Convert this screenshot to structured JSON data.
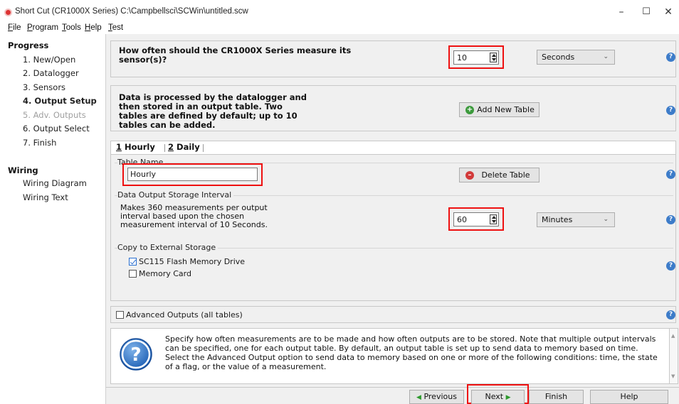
{
  "window": {
    "title": "Short Cut (CR1000X Series) C:\\Campbellsci\\SCWin\\untitled.scw",
    "minimize": "–",
    "maximize": "☐",
    "close": "✕"
  },
  "menu": [
    "File",
    "Program",
    "Tools",
    "Help",
    "Test"
  ],
  "nav": {
    "progress_heading": "Progress",
    "progress_items": [
      "1. New/Open",
      "2. Datalogger",
      "3. Sensors",
      "4. Output Setup",
      "5. Adv. Outputs",
      "6. Output Select",
      "7. Finish"
    ],
    "current_index": 3,
    "disabled_index": 4,
    "wiring_heading": "Wiring",
    "wiring_items": [
      "Wiring Diagram",
      "Wiring Text"
    ]
  },
  "measure": {
    "question": "How often should the CR1000X Series measure its sensor(s)?",
    "interval_value": "10",
    "interval_unit": "Seconds"
  },
  "tables": {
    "description": "Data is processed by the datalogger and then stored in an output table. Two tables are defined by default; up to 10 tables can be added.",
    "add_button": "Add New Table",
    "tabs": [
      {
        "num": "1",
        "label": "Hourly"
      },
      {
        "num": "2",
        "label": "Daily"
      }
    ],
    "table_name_label": "Table Name",
    "table_name_value": "Hourly",
    "delete_button": "Delete Table",
    "interval_group_label": "Data Output Storage Interval",
    "interval_desc": "Makes 360 measurements per output interval based upon the chosen measurement interval of 10 Seconds.",
    "output_interval_value": "60",
    "output_interval_unit": "Minutes",
    "external_group_label": "Copy to External Storage",
    "sc115_label": "SC115 Flash Memory Drive",
    "sc115_checked": true,
    "memory_card_label": "Memory Card",
    "memory_card_checked": false
  },
  "advanced": {
    "label": "Advanced Outputs (all tables)",
    "checked": false
  },
  "info": {
    "text": "Specify how often measurements are to be made and how often outputs are to be stored. Note that multiple output intervals can be specified, one for each output table. By default, an output table is set up to send data to memory based on time. Select the Advanced Output option to send data to memory based on one or more of the following conditions: time, the state of a flag, or the value of a measurement."
  },
  "footer": {
    "previous": "Previous",
    "next": "Next",
    "finish": "Finish",
    "help": "Help"
  },
  "colors": {
    "highlight": "#e11111",
    "help_icon": "#3d7cc9",
    "add_icon": "#3c9a3c",
    "delete_icon": "#d23a3a"
  }
}
